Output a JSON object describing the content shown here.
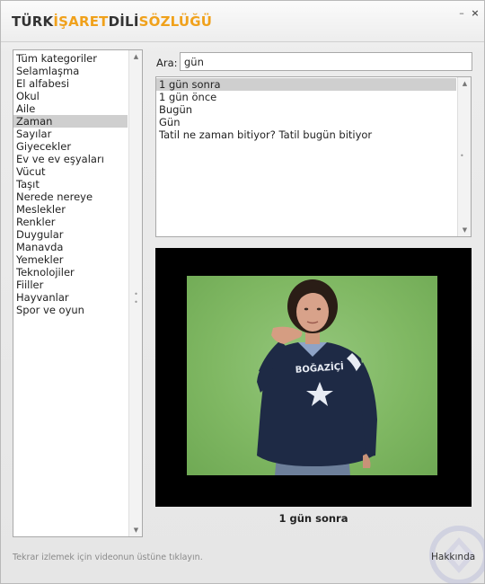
{
  "app": {
    "title_parts": [
      "TÜRK",
      "İŞARET",
      "DİLİ",
      "SÖZLÜĞÜ"
    ]
  },
  "window_controls": {
    "minimize_glyph": "–",
    "close_glyph": "×"
  },
  "categories": {
    "items": [
      "Tüm kategoriler",
      "Selamlaşma",
      "El alfabesi",
      "Okul",
      "Aile",
      "Zaman",
      "Sayılar",
      "Giyecekler",
      "Ev ve ev eşyaları",
      "Vücut",
      "Taşıt",
      "Nerede nereye",
      "Meslekler",
      "Renkler",
      "Duygular",
      "Manavda",
      "Yemekler",
      "Teknolojiler",
      "Fiiller",
      "Hayvanlar",
      "Spor ve oyun"
    ],
    "selected_index": 5
  },
  "search": {
    "label": "Ara:",
    "value": "gün"
  },
  "results": {
    "items": [
      "1 gün sonra",
      "1 gün önce",
      "Bugün",
      "Gün",
      "Tatil ne zaman bitiyor? Tatil bugün bitiyor"
    ],
    "selected_index": 0
  },
  "video": {
    "caption": "1 gün sonra",
    "shirt_text": "BOĞAZİÇİ"
  },
  "footer": {
    "hint": "Tekrar izlemek için videonun üstüne tıklayın.",
    "about_label": "Hakkında"
  },
  "colors": {
    "accent": "#f0a11b",
    "selection": "#cfcfcf",
    "video_bg": "#000000",
    "green_screen": "#80b863"
  },
  "icons": {
    "scroll_up": "triangle-up-icon",
    "scroll_down": "triangle-down-icon"
  }
}
